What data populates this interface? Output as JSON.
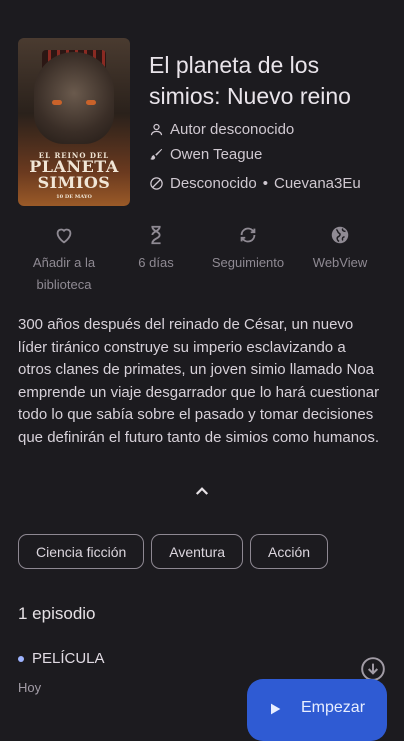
{
  "manga": {
    "title": "El planeta de los simios: Nuevo reino",
    "author": "Autor desconocido",
    "artist": "Owen Teague",
    "status": "Desconocido",
    "source": "Cuevana3Eu",
    "separator": "•",
    "poster": {
      "small": "EL REINO DEL",
      "big1": "PLANETA",
      "big2": "SIMIOS",
      "date": "10 DE MAYO"
    }
  },
  "actions": [
    {
      "label": "Añadir a la biblioteca",
      "icon": "heart-outline-icon"
    },
    {
      "label": "6 días",
      "icon": "hourglass-icon"
    },
    {
      "label": "Seguimiento",
      "icon": "sync-icon"
    },
    {
      "label": "WebView",
      "icon": "globe-icon"
    }
  ],
  "description": "300 años después del reinado de César, un nuevo líder tiránico construye su imperio esclavizando a otros clanes de primates, un joven simio llamado Noa emprende un viaje desgarrador que lo hará cuestionar todo lo que sabía sobre el pasado y tomar decisiones que definirán el futuro tanto de simios como humanos.",
  "genres": [
    "Ciencia ficción",
    "Aventura",
    "Acción"
  ],
  "episodes": {
    "count_label": "1 episodio",
    "items": [
      {
        "title": "PELÍCULA",
        "date": "Hoy"
      }
    ]
  },
  "fab": {
    "label": "Empezar"
  },
  "colors": {
    "accent": "#2f5bd3",
    "background": "#1c1b1f",
    "unread_dot": "#9fb4ff"
  }
}
